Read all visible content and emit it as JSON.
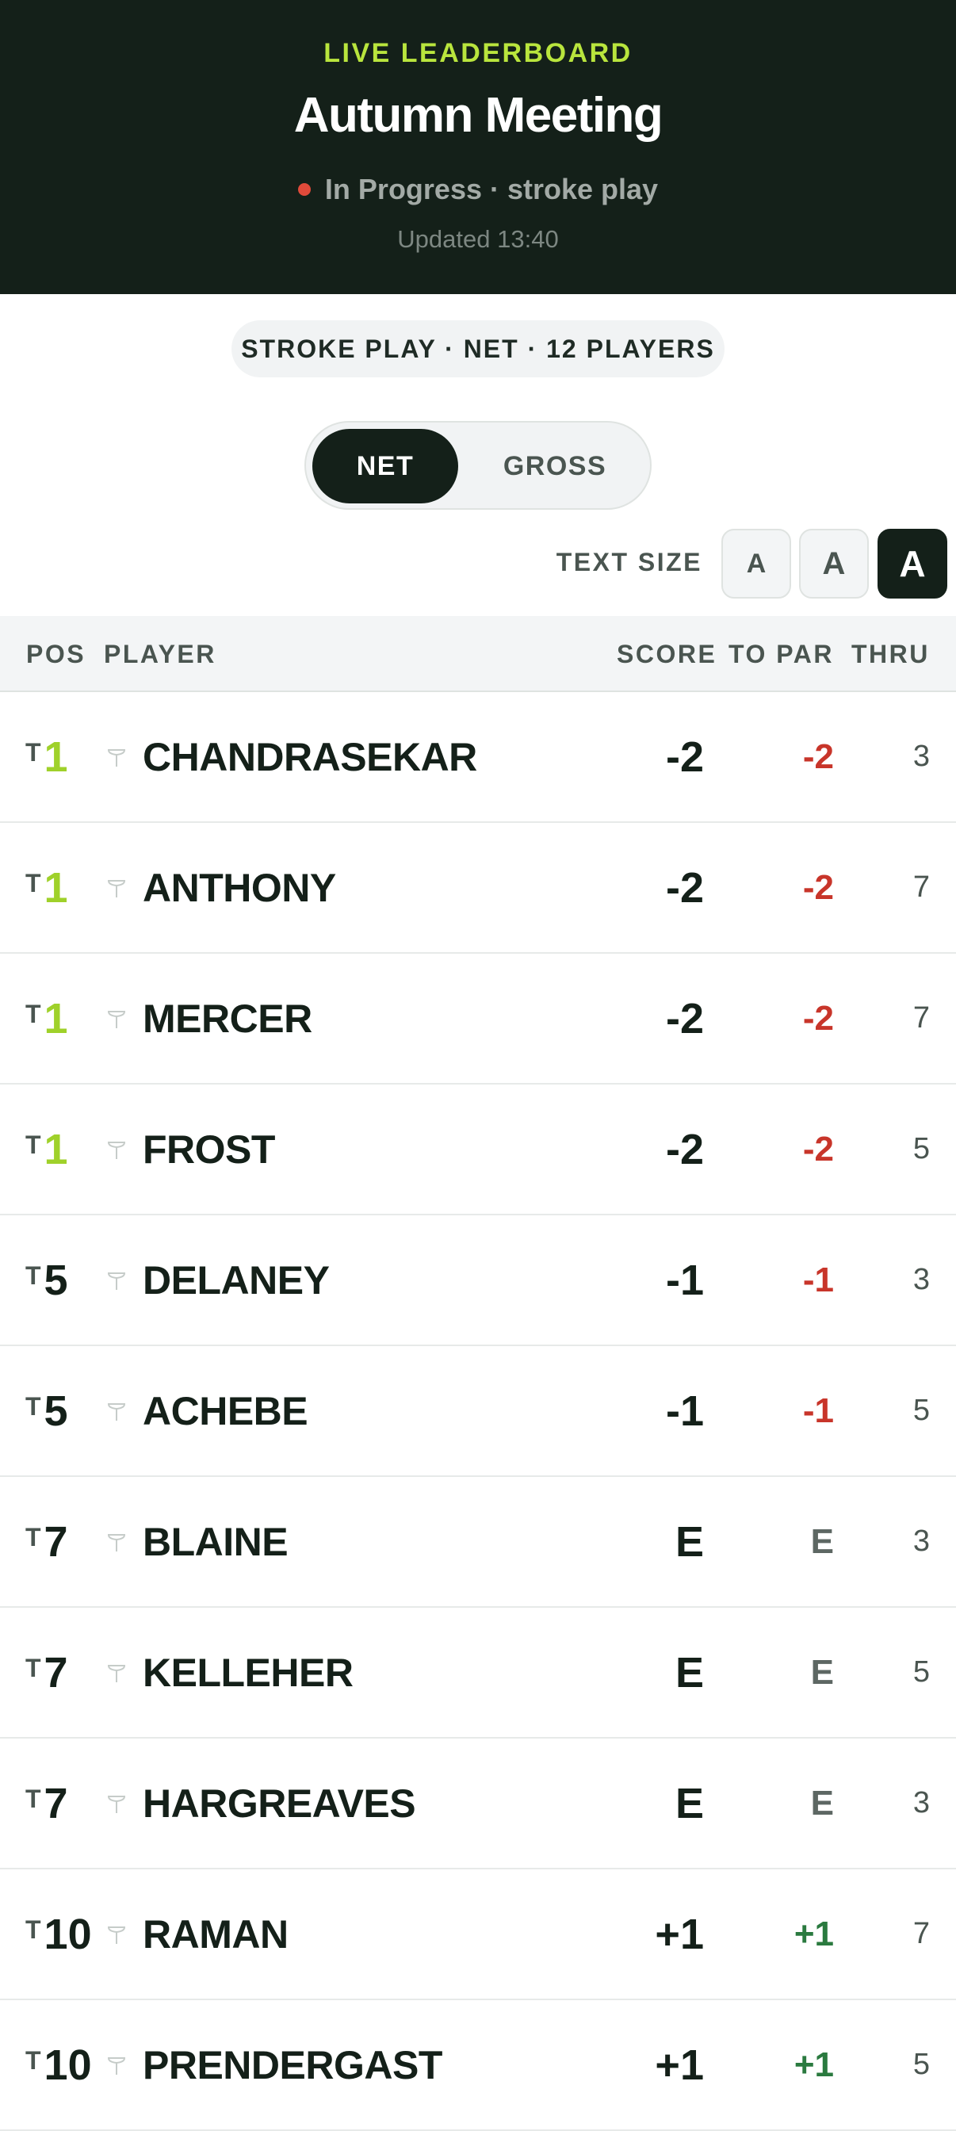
{
  "header": {
    "eyebrow": "LIVE LEADERBOARD",
    "title": "Autumn Meeting",
    "status": "In Progress · stroke play",
    "updated": "Updated 13:40",
    "accent_color": "#b9e53d",
    "status_dot_color": "#e04a3a"
  },
  "format_pill": "STROKE PLAY · NET · 12 PLAYERS",
  "score_toggle": {
    "net_label": "NET",
    "gross_label": "GROSS",
    "selected": "NET"
  },
  "text_size": {
    "label": "TEXT SIZE",
    "small_label": "A",
    "medium_label": "A",
    "large_label": "A",
    "selected": "large"
  },
  "table": {
    "headers": {
      "pos": "POS",
      "player": "PLAYER",
      "score": "SCORE",
      "to_par": "TO PAR",
      "thru": "THRU"
    },
    "rows": [
      {
        "tie": "T",
        "pos": "1",
        "player": "CHANDRASEKAR",
        "score": "-2",
        "to_par": "-2",
        "thru": "3"
      },
      {
        "tie": "T",
        "pos": "1",
        "player": "ANTHONY",
        "score": "-2",
        "to_par": "-2",
        "thru": "7"
      },
      {
        "tie": "T",
        "pos": "1",
        "player": "MERCER",
        "score": "-2",
        "to_par": "-2",
        "thru": "7"
      },
      {
        "tie": "T",
        "pos": "1",
        "player": "FROST",
        "score": "-2",
        "to_par": "-2",
        "thru": "5"
      },
      {
        "tie": "T",
        "pos": "5",
        "player": "DELANEY",
        "score": "-1",
        "to_par": "-1",
        "thru": "3"
      },
      {
        "tie": "T",
        "pos": "5",
        "player": "ACHEBE",
        "score": "-1",
        "to_par": "-1",
        "thru": "5"
      },
      {
        "tie": "T",
        "pos": "7",
        "player": "BLAINE",
        "score": "E",
        "to_par": "E",
        "thru": "3"
      },
      {
        "tie": "T",
        "pos": "7",
        "player": "KELLEHER",
        "score": "E",
        "to_par": "E",
        "thru": "5"
      },
      {
        "tie": "T",
        "pos": "7",
        "player": "HARGREAVES",
        "score": "E",
        "to_par": "E",
        "thru": "3"
      },
      {
        "tie": "T",
        "pos": "10",
        "player": "RAMAN",
        "score": "+1",
        "to_par": "+1",
        "thru": "7"
      },
      {
        "tie": "T",
        "pos": "10",
        "player": "PRENDERGAST",
        "score": "+1",
        "to_par": "+1",
        "thru": "5"
      }
    ]
  },
  "colors": {
    "header_bg": "#142019",
    "leader_pos": "#9fd12a",
    "under_par": "#c8352a",
    "even_par": "#5d6763",
    "over_par": "#2a7a3f"
  },
  "icons": {
    "row_marker": "golf-tee-icon"
  }
}
